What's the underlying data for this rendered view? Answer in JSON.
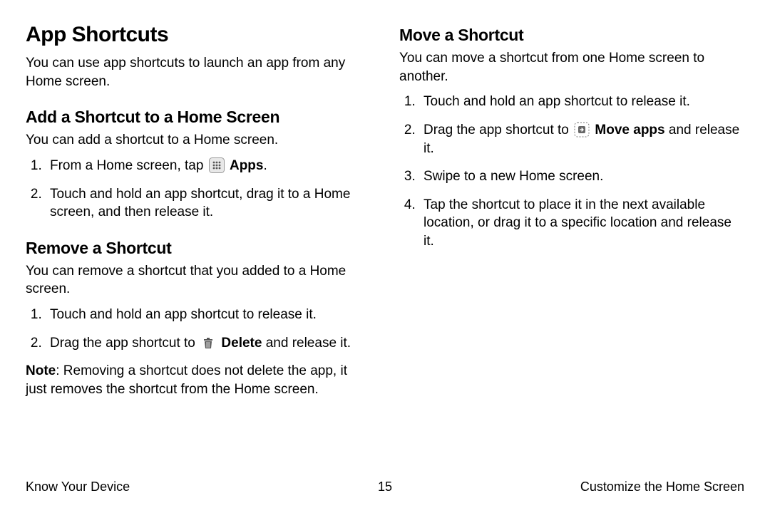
{
  "title": "App Shortcuts",
  "intro": "You can use app shortcuts to launch an app from any Home screen.",
  "add": {
    "heading": "Add a Shortcut to a Home Screen",
    "desc": "You can add a shortcut to a Home screen.",
    "step1_pre": "From a Home screen, tap ",
    "step1_label": "Apps",
    "step1_post": ".",
    "step2": "Touch and hold an app shortcut, drag it to a Home screen, and then release it."
  },
  "remove": {
    "heading": "Remove a Shortcut",
    "desc": "You can remove a shortcut that you added to a Home screen.",
    "step1": "Touch and hold an app shortcut to release it.",
    "step2_pre": "Drag the app shortcut to ",
    "step2_label": "Delete",
    "step2_post": " and release it.",
    "note_label": "Note",
    "note_body": ": Removing a shortcut does not delete the app, it just removes the shortcut from the Home screen."
  },
  "move": {
    "heading": "Move a Shortcut",
    "desc": "You can move a shortcut from one Home screen to another.",
    "step1": "Touch and hold an app shortcut to release it.",
    "step2_pre": "Drag the app shortcut to ",
    "step2_label": "Move apps",
    "step2_post": " and release it.",
    "step3": "Swipe to a new Home screen.",
    "step4": "Tap the shortcut to place it in the next available location, or drag it to a specific location and release it."
  },
  "footer": {
    "left": "Know Your Device",
    "center": "15",
    "right": "Customize the Home Screen"
  }
}
